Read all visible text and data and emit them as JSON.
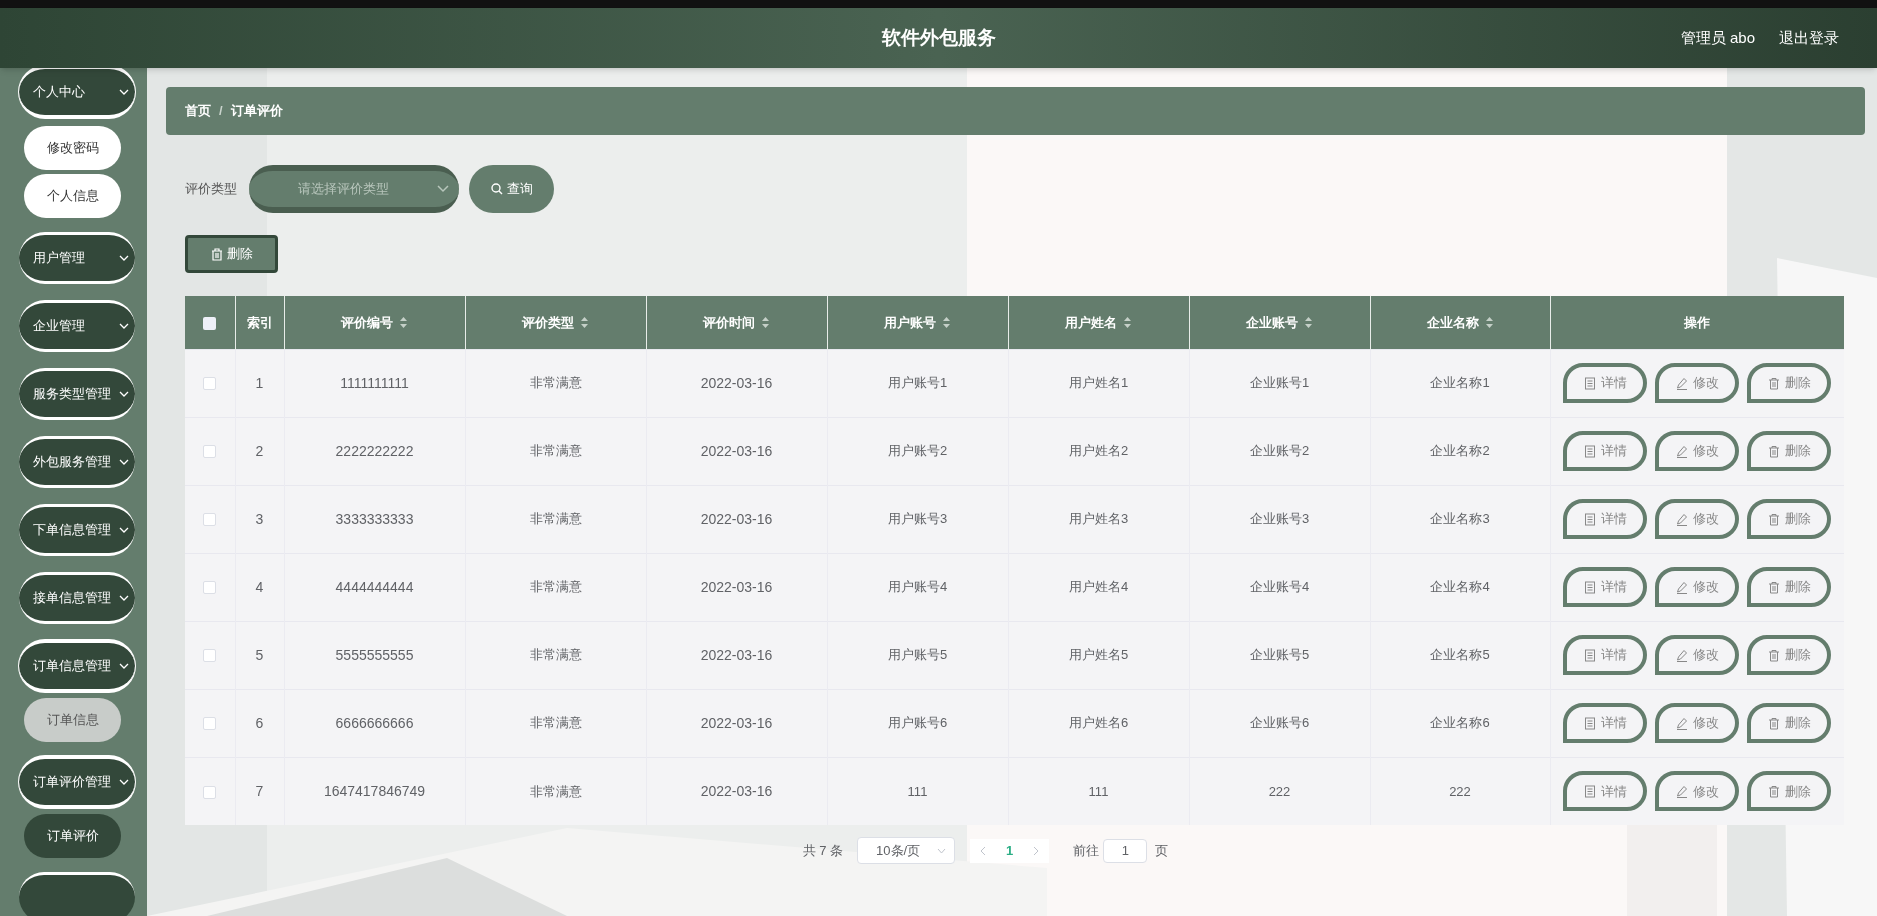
{
  "header": {
    "title": "软件外包服务",
    "user": "管理员 abo",
    "logout": "退出登录"
  },
  "sidebar": {
    "items": [
      {
        "label": "个人中心",
        "expanded": true,
        "children": [
          {
            "label": "修改密码",
            "selected": false,
            "highlighted": false
          },
          {
            "label": "个人信息",
            "selected": false,
            "highlighted": false
          }
        ]
      },
      {
        "label": "用户管理",
        "expanded": false
      },
      {
        "label": "企业管理",
        "expanded": false
      },
      {
        "label": "服务类型管理",
        "expanded": false
      },
      {
        "label": "外包服务管理",
        "expanded": false
      },
      {
        "label": "下单信息管理",
        "expanded": false
      },
      {
        "label": "接单信息管理",
        "expanded": false
      },
      {
        "label": "订单信息管理",
        "expanded": true,
        "children": [
          {
            "label": "订单信息",
            "selected": false,
            "highlighted": true
          }
        ]
      },
      {
        "label": "订单评价管理",
        "expanded": true,
        "children": [
          {
            "label": "订单评价",
            "selected": true,
            "highlighted": false
          }
        ]
      }
    ]
  },
  "breadcrumb": {
    "items": [
      "首页",
      "订单评价"
    ],
    "separator": "/"
  },
  "filter": {
    "label": "评价类型",
    "placeholder": "请选择评价类型",
    "search_button": "查询"
  },
  "delete_button": "删除",
  "table": {
    "columns": [
      "索引",
      "评价编号",
      "评价类型",
      "评价时间",
      "用户账号",
      "用户姓名",
      "企业账号",
      "企业名称",
      "操作"
    ],
    "sortable": [
      false,
      true,
      true,
      true,
      true,
      true,
      true,
      true,
      false
    ],
    "header_checked": false,
    "rows": [
      {
        "checked": false,
        "cells": [
          "1",
          "1111111111",
          "非常满意",
          "2022-03-16",
          "用户账号1",
          "用户姓名1",
          "企业账号1",
          "企业名称1"
        ],
        "actions": [
          "详情",
          "修改",
          "删除"
        ]
      },
      {
        "checked": false,
        "cells": [
          "2",
          "2222222222",
          "非常满意",
          "2022-03-16",
          "用户账号2",
          "用户姓名2",
          "企业账号2",
          "企业名称2"
        ],
        "actions": [
          "详情",
          "修改",
          "删除"
        ]
      },
      {
        "checked": false,
        "cells": [
          "3",
          "3333333333",
          "非常满意",
          "2022-03-16",
          "用户账号3",
          "用户姓名3",
          "企业账号3",
          "企业名称3"
        ],
        "actions": [
          "详情",
          "修改",
          "删除"
        ]
      },
      {
        "checked": false,
        "cells": [
          "4",
          "4444444444",
          "非常满意",
          "2022-03-16",
          "用户账号4",
          "用户姓名4",
          "企业账号4",
          "企业名称4"
        ],
        "actions": [
          "详情",
          "修改",
          "删除"
        ]
      },
      {
        "checked": false,
        "cells": [
          "5",
          "5555555555",
          "非常满意",
          "2022-03-16",
          "用户账号5",
          "用户姓名5",
          "企业账号5",
          "企业名称5"
        ],
        "actions": [
          "详情",
          "修改",
          "删除"
        ]
      },
      {
        "checked": false,
        "cells": [
          "6",
          "6666666666",
          "非常满意",
          "2022-03-16",
          "用户账号6",
          "用户姓名6",
          "企业账号6",
          "企业名称6"
        ],
        "actions": [
          "详情",
          "修改",
          "删除"
        ]
      },
      {
        "checked": false,
        "cells": [
          "7",
          "1647417846749",
          "非常满意",
          "2022-03-16",
          "111",
          "111",
          "222",
          "222"
        ],
        "actions": [
          "详情",
          "修改",
          "删除"
        ]
      }
    ]
  },
  "pagination": {
    "total": "共 7 条",
    "page_size": "10条/页",
    "current_page": "1",
    "goto_label": "前往",
    "goto_value": "1",
    "page_suffix": "页"
  }
}
